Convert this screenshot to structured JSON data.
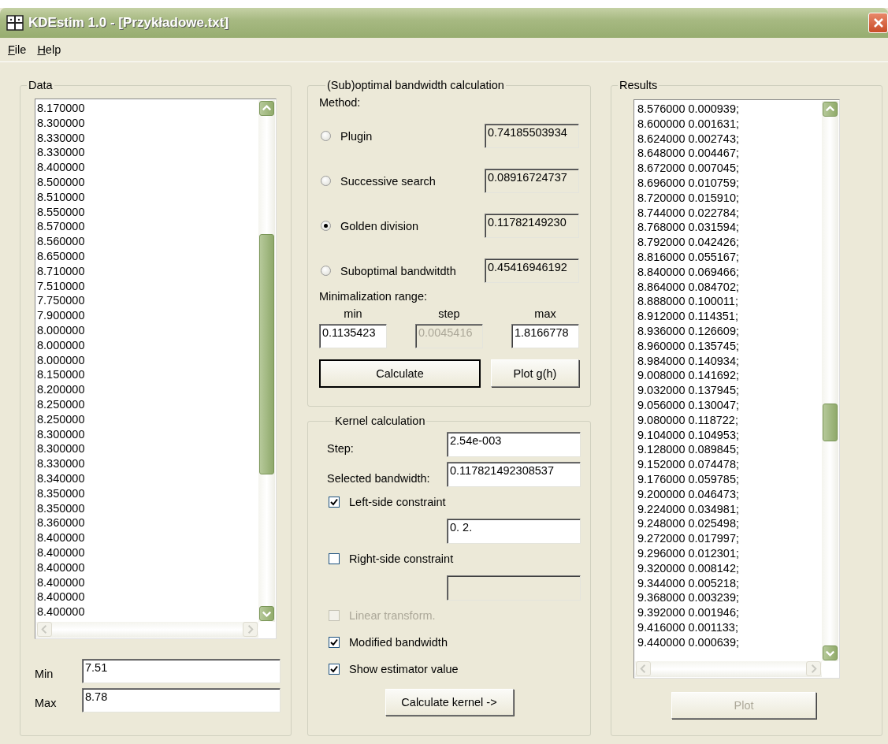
{
  "window": {
    "title": "KDEstim 1.0 - [Przykładowe.txt]"
  },
  "menu": [
    {
      "label": "File"
    },
    {
      "label": "Help"
    }
  ],
  "data": {
    "title": "Data",
    "values": [
      "8.170000",
      "8.300000",
      "8.330000",
      "8.330000",
      "8.400000",
      "8.500000",
      "8.510000",
      "8.550000",
      "8.570000",
      "8.560000",
      "8.650000",
      "8.710000",
      "7.510000",
      "7.750000",
      "7.900000",
      "8.000000",
      "8.000000",
      "8.000000",
      "8.150000",
      "8.200000",
      "8.250000",
      "8.250000",
      "8.300000",
      "8.300000",
      "8.330000",
      "8.340000",
      "8.350000",
      "8.350000",
      "8.360000",
      "8.400000",
      "8.400000",
      "8.400000",
      "8.400000",
      "8.400000",
      "8.400000"
    ],
    "min": {
      "label": "Min",
      "value": "7.51"
    },
    "max": {
      "label": "Max",
      "value": "8.78"
    }
  },
  "bandwidth": {
    "title": "(Sub)optimal bandwidth calculation",
    "method_label": "Method:",
    "methods": [
      {
        "label": "Plugin",
        "selected": false,
        "value": "0.74185503934"
      },
      {
        "label": "Successive search",
        "selected": false,
        "value": "0.08916724737"
      },
      {
        "label": "Golden division",
        "selected": true,
        "value": "0.11782149230"
      },
      {
        "label": "Suboptimal bandwitdth",
        "selected": false,
        "value": "0.45416946192"
      }
    ],
    "range_label": "Minimalization range:",
    "range": [
      {
        "label": "min",
        "value": "0.1135423",
        "disabled": false
      },
      {
        "label": "step",
        "value": "0.0045416",
        "disabled": true
      },
      {
        "label": "max",
        "value": "1.8166778",
        "disabled": false
      }
    ],
    "buttons": [
      {
        "label": "Calculate",
        "default": true
      },
      {
        "label": "Plot g(h)",
        "default": false
      }
    ]
  },
  "kernel": {
    "title": "Kernel calculation",
    "rows": [
      {
        "kind": "field",
        "label": "Step:",
        "value": "2.54e-003",
        "disabled": false
      },
      {
        "kind": "field",
        "label": "Selected bandwidth:",
        "value": "0.117821492308537",
        "disabled": false
      },
      {
        "kind": "checkbox",
        "label": "Left-side constraint",
        "checked": true,
        "disabled": false
      },
      {
        "kind": "field",
        "value": "0. 2.",
        "disabled": false
      },
      {
        "kind": "checkbox",
        "label": "Right-side constraint",
        "checked": false,
        "disabled": false
      },
      {
        "kind": "field",
        "disabled": true
      },
      {
        "kind": "checkbox",
        "label": "Linear transform.",
        "checked": false,
        "disabled": true
      },
      {
        "kind": "checkbox",
        "label": "Modified bandwidth",
        "checked": true,
        "disabled": false
      },
      {
        "kind": "checkbox",
        "label": "Show estimator value",
        "checked": true,
        "disabled": false
      }
    ],
    "button": {
      "label": "Calculate kernel ->",
      "disabled": false
    }
  },
  "results": {
    "title": "Results",
    "values": [
      "8.576000 0.000939;",
      "8.600000 0.001631;",
      "8.624000 0.002743;",
      "8.648000 0.004467;",
      "8.672000 0.007045;",
      "8.696000 0.010759;",
      "8.720000 0.015910;",
      "8.744000 0.022784;",
      "8.768000 0.031594;",
      "8.792000 0.042426;",
      "8.816000 0.055167;",
      "8.840000 0.069466;",
      "8.864000 0.084702;",
      "8.888000 0.100011;",
      "8.912000 0.114351;",
      "8.936000 0.126609;",
      "8.960000 0.135745;",
      "8.984000 0.140934;",
      "9.008000 0.141692;",
      "9.032000 0.137945;",
      "9.056000 0.130047;",
      "9.080000 0.118722;",
      "9.104000 0.104953;",
      "9.128000 0.089845;",
      "9.152000 0.074478;",
      "9.176000 0.059785;",
      "9.200000 0.046473;",
      "9.224000 0.034981;",
      "9.248000 0.025498;",
      "9.272000 0.017997;",
      "9.296000 0.012301;",
      "9.320000 0.008142;",
      "9.344000 0.005218;",
      "9.368000 0.003239;",
      "9.392000 0.001946;",
      "9.416000 0.001133;",
      "9.440000 0.000639;"
    ],
    "button": {
      "label": "Plot",
      "disabled": true
    }
  }
}
